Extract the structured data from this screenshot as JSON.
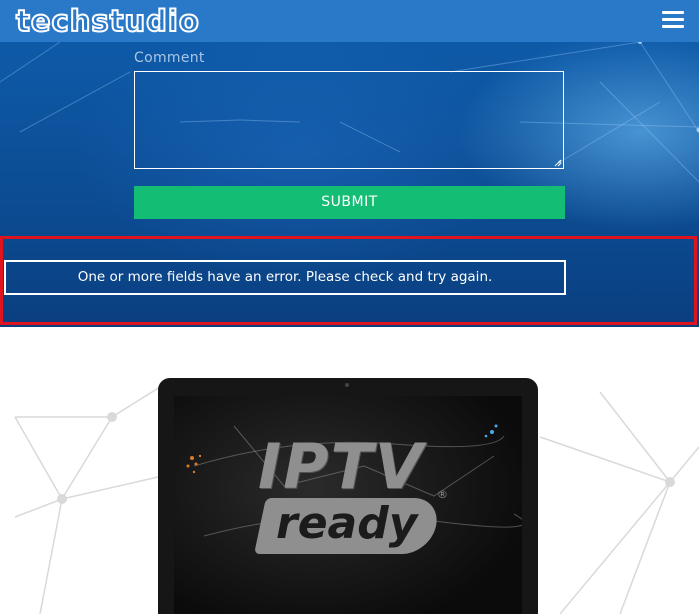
{
  "header": {
    "logo_text": "techstudio",
    "menu_icon": "hamburger-menu-icon"
  },
  "form": {
    "comment_label": "Comment",
    "comment_value": "",
    "submit_label": "SUBMIT",
    "error_message": "One or more fields have an error. Please check and try again."
  },
  "hero_image": {
    "title": "IPTV",
    "badge": "ready",
    "mark": "®"
  },
  "colors": {
    "header_bg": "#2a78c8",
    "form_bg": "#0c4c93",
    "submit_bg": "#13bd73",
    "highlight_border": "#e0141e"
  }
}
